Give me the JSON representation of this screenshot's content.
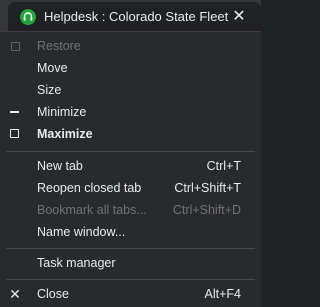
{
  "tab": {
    "title": "Helpdesk : Colorado State Fleet",
    "close": "✕"
  },
  "menu": {
    "restore": "Restore",
    "move": "Move",
    "size": "Size",
    "minimize": "Minimize",
    "maximize": "Maximize",
    "new_tab": "New tab",
    "new_tab_shortcut": "Ctrl+T",
    "reopen": "Reopen closed tab",
    "reopen_shortcut": "Ctrl+Shift+T",
    "bookmark": "Bookmark all tabs...",
    "bookmark_shortcut": "Ctrl+Shift+D",
    "name_window": "Name window...",
    "task_manager": "Task manager",
    "close": "Close",
    "close_shortcut": "Alt+F4",
    "close_icon": "✕"
  },
  "colors": {
    "favicon": "#22a33b",
    "menu_bg": "#292a2d",
    "disabled_text": "#6f7175"
  }
}
